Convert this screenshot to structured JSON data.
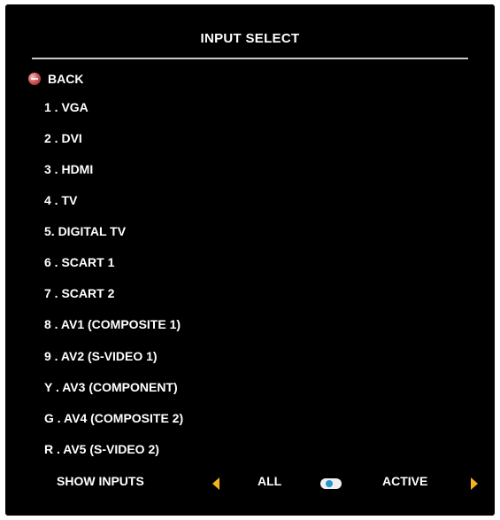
{
  "menu": {
    "title": "INPUT SELECT",
    "back_label": "BACK",
    "inputs": [
      "1 .  VGA",
      "2 .  DVI",
      "3 .  HDMI",
      "4 .  TV",
      "5. DIGITAL TV",
      "6 . SCART 1",
      "7 . SCART 2",
      "8 . AV1 (COMPOSITE 1)",
      "9 . AV2 (S-VIDEO 1)",
      "Y . AV3 (COMPONENT)",
      "G . AV4 (COMPOSITE 2)",
      "R . AV5 (S-VIDEO 2)"
    ]
  },
  "footer": {
    "show_inputs_label": "SHOW INPUTS",
    "all_label": "ALL",
    "active_label": "ACTIVE"
  },
  "colors": {
    "background": "#000000",
    "text": "#ffffff",
    "arrow": "#f2b51d",
    "toggle_dot": "#2a95c8",
    "back_icon": "#d25a5a"
  },
  "icons": {
    "back": "back-icon",
    "left": "left-arrow-icon",
    "right": "right-arrow-icon",
    "toggle": "toggle-icon"
  }
}
